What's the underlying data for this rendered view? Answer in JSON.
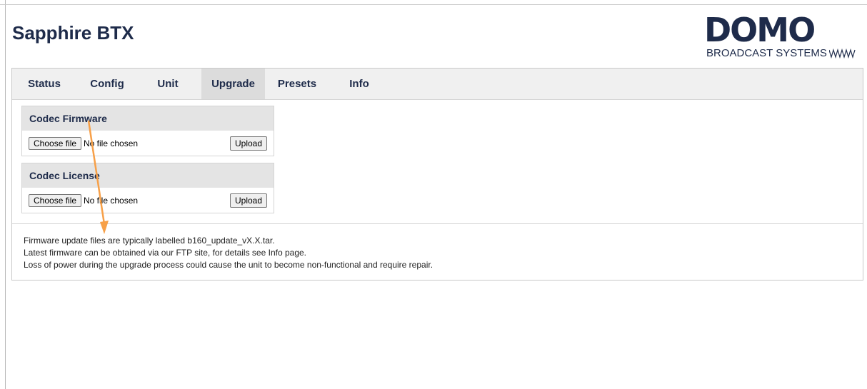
{
  "header": {
    "title": "Sapphire BTX"
  },
  "logo": {
    "wordmark": "DOMO",
    "tagline": "BROADCAST SYSTEMS"
  },
  "tabs": [
    {
      "label": "Status",
      "active": false
    },
    {
      "label": "Config",
      "active": false
    },
    {
      "label": "Unit",
      "active": false
    },
    {
      "label": "Upgrade",
      "active": true
    },
    {
      "label": "Presets",
      "active": false
    },
    {
      "label": "Info",
      "active": false
    }
  ],
  "upload_sections": [
    {
      "title": "Codec Firmware",
      "choose_label": "Choose file",
      "file_status": "No file chosen",
      "upload_label": "Upload"
    },
    {
      "title": "Codec License",
      "choose_label": "Choose file",
      "file_status": "No file chosen",
      "upload_label": "Upload"
    }
  ],
  "notes": [
    "Firmware update files are typically labelled b160_update_vX.X.tar.",
    "Latest firmware can be obtained via our FTP site, for details see Info page.",
    "Loss of power during the upgrade process could cause the unit to become non-functional and require repair."
  ],
  "colors": {
    "brand_navy": "#1e2b4a",
    "tab_bar": "#f0f0f0",
    "tab_active": "#dcdcdc",
    "annotation_arrow": "#f7a048"
  }
}
